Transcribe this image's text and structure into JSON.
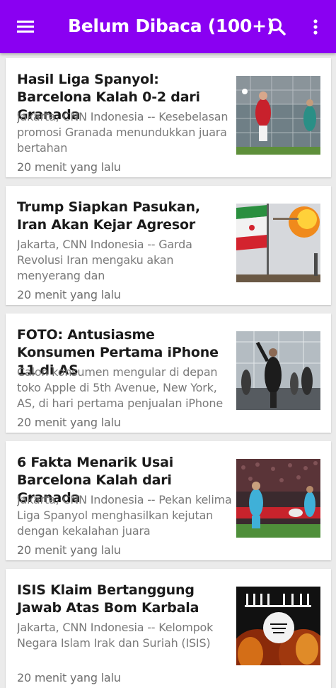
{
  "appbar": {
    "title": "Belum Dibaca (100+)",
    "menu_icon": "hamburger-menu-icon",
    "search_icon": "search-icon",
    "more_icon": "more-vertical-icon",
    "color": "#8a00f2"
  },
  "articles": [
    {
      "headline": "Hasil Liga Spanyol: Barcelona Kalah 0-2 dari Granada",
      "summary": "Jakarta, CNN Indonesia -- Kesebelasan promosi Granada menundukkan juara bertahan",
      "time": "20 menit yang lalu"
    },
    {
      "headline": "Trump Siapkan Pasukan, Iran Akan Kejar Agresor",
      "summary": "Jakarta, CNN Indonesia -- Garda Revolusi Iran  mengaku akan menyerang dan",
      "time": "20 menit yang lalu"
    },
    {
      "headline": "FOTO: Antusiasme Konsumen Pertama iPhone 11 di AS",
      "summary": "Calon konsumen mengular di depan toko Apple di 5th Avenue, New York, AS, di hari pertama penjualan iPhone",
      "time": "20 menit yang lalu"
    },
    {
      "headline": "6 Fakta Menarik Usai Barcelona Kalah dari Granada",
      "summary": "Jakarta, CNN Indonesia -- Pekan kelima Liga Spanyol menghasilkan kejutan dengan kekalahan juara",
      "time": "20 menit yang lalu"
    },
    {
      "headline": "ISIS Klaim Bertanggung Jawab Atas Bom Karbala",
      "summary": "Jakarta, CNN Indonesia -- Kelompok Negara Islam Irak dan Suriah (ISIS)",
      "time": "20 menit yang lalu"
    }
  ]
}
